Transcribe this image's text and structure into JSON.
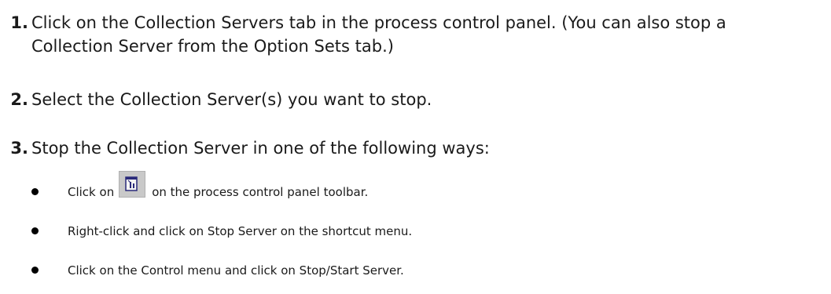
{
  "steps": [
    {
      "number": "1.",
      "text": "Click on the Collection Servers tab in the process control panel. (You can also stop a",
      "continuation": "Collection Server from the Option Sets tab.)"
    },
    {
      "number": "2.",
      "text": "Select the Collection Server(s) you want to stop."
    },
    {
      "number": "3.",
      "text": "Stop the Collection Server in one of the following ways:"
    }
  ],
  "bullets": [
    {
      "before_icon": "Click on",
      "icon": "stop-server-icon",
      "after_icon": "on the process control panel toolbar."
    },
    {
      "text": "Right-click and click on Stop Server on the shortcut menu."
    },
    {
      "text": "Click on the Control menu and click on Stop/Start Server."
    }
  ]
}
